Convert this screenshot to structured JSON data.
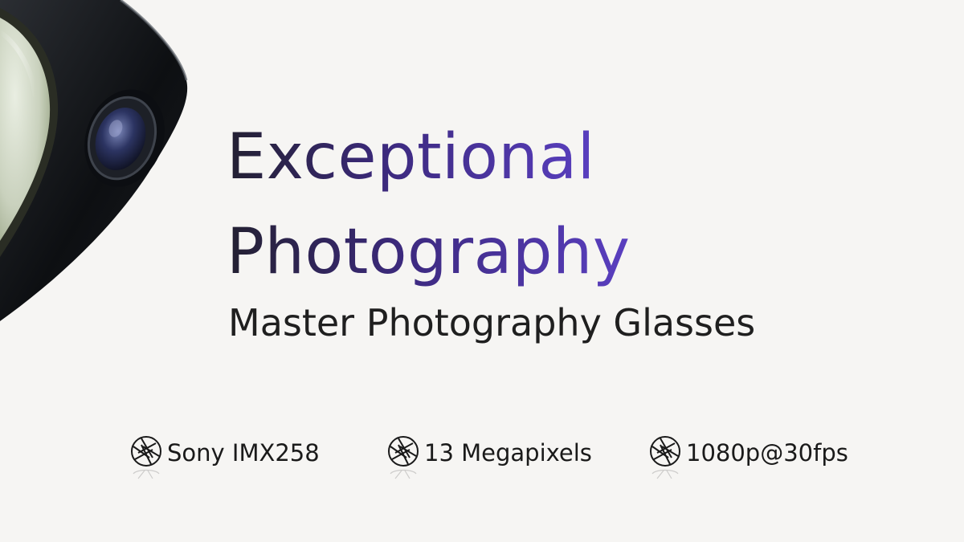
{
  "headline": {
    "line1": "Exceptional",
    "line2": "Photography"
  },
  "subtitle": "Master Photography Glasses",
  "specs": [
    {
      "icon": "aperture-icon",
      "label": "Sony IMX258"
    },
    {
      "icon": "aperture-icon",
      "label": "13 Megapixels"
    },
    {
      "icon": "aperture-icon",
      "label": "1080p@30fps"
    }
  ],
  "colors": {
    "background": "#f6f5f3",
    "headline_gradient_start": "#232031",
    "headline_gradient_end": "#5a3fc0",
    "text": "#1a1a1a"
  }
}
